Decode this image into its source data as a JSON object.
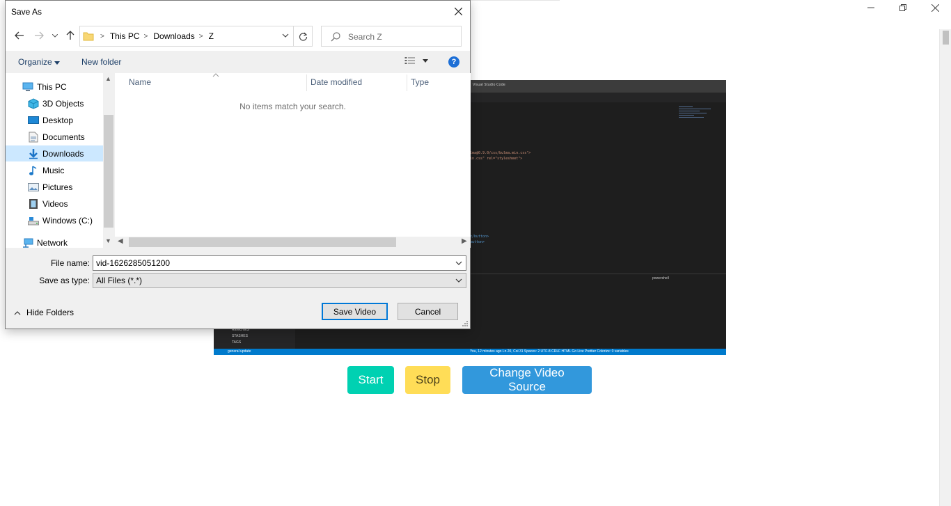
{
  "background_window": {
    "buttons": {
      "start": "Start",
      "stop": "Stop",
      "change_source": "Change Video Source"
    },
    "video_preview": {
      "code_line_1": "lma@0.9.0/css/bulma.min.css\">",
      "code_line_2": "in.css\" rel=\"stylesheet\">",
      "code_line_3": "</button>",
      "code_line_4": "button>",
      "terminal_label": "powershell",
      "sidebar_items": [
        "REMOTES",
        "STASHES",
        "TAGS"
      ],
      "status_left": "general update",
      "status_right": "You, 12 minutes ago   Ln 20, Col 31   Spaces: 2   UTF-8   CRLF   HTML   Go Live   Prettier   Colorize: 0 variables"
    }
  },
  "dialog": {
    "title": "Save As",
    "address": {
      "crumbs": [
        "This PC",
        "Downloads",
        "Z"
      ]
    },
    "search": {
      "placeholder": "Search Z"
    },
    "commands": {
      "organize": "Organize",
      "new_folder": "New folder",
      "help": "?"
    },
    "nav_items": [
      {
        "label": "This PC",
        "icon": "computer-icon"
      },
      {
        "label": "3D Objects",
        "icon": "cube-icon"
      },
      {
        "label": "Desktop",
        "icon": "desktop-icon"
      },
      {
        "label": "Documents",
        "icon": "document-icon"
      },
      {
        "label": "Downloads",
        "icon": "download-icon",
        "selected": true
      },
      {
        "label": "Music",
        "icon": "music-icon"
      },
      {
        "label": "Pictures",
        "icon": "picture-icon"
      },
      {
        "label": "Videos",
        "icon": "video-icon"
      },
      {
        "label": "Windows (C:)",
        "icon": "drive-icon"
      },
      {
        "label": "Network",
        "icon": "network-icon"
      }
    ],
    "columns": [
      "Name",
      "Date modified",
      "Type"
    ],
    "empty_message": "No items match your search.",
    "file_name_label": "File name:",
    "file_name_value": "vid-1626285051200",
    "save_type_label": "Save as type:",
    "save_type_value": "All Files (*.*)",
    "hide_folders": "Hide Folders",
    "save_button": "Save Video",
    "cancel_button": "Cancel"
  }
}
